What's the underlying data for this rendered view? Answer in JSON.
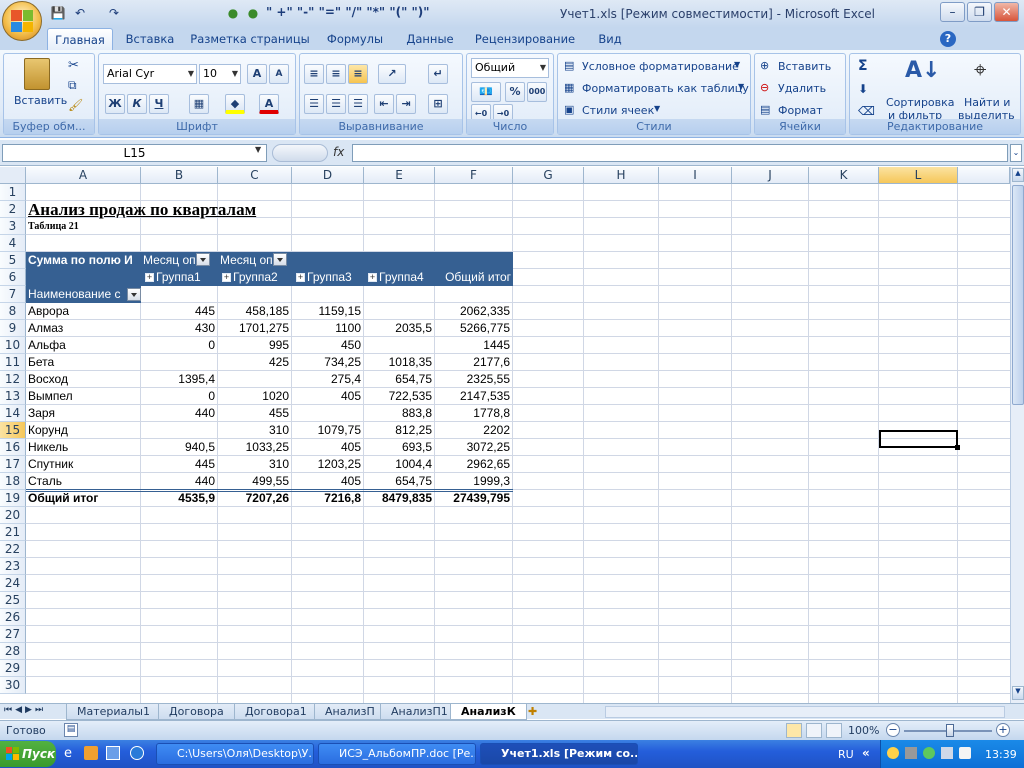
{
  "window": {
    "title": "Учет1.xls  [Режим совместимости] - Microsoft Excel"
  },
  "qat": {
    "formula_buttons": "\" +\" \"-\" \"=\" \"/\" \"*\" \"(\" \")\""
  },
  "tabs": [
    "Главная",
    "Вставка",
    "Разметка страницы",
    "Формулы",
    "Данные",
    "Рецензирование",
    "Вид"
  ],
  "ribbon": {
    "clipboard": {
      "paste": "Вставить",
      "label": "Буфер обм..."
    },
    "font": {
      "name": "Arial Cyr",
      "size": "10",
      "bold": "Ж",
      "italic": "К",
      "underline": "Ч",
      "label": "Шрифт"
    },
    "alignment": {
      "label": "Выравнивание"
    },
    "number": {
      "format": "Общий",
      "label": "Число",
      "percent": "%",
      "thousands": "000"
    },
    "styles": {
      "conditional": "Условное форматирование",
      "as_table": "Форматировать как таблицу",
      "cell_styles": "Стили ячеек",
      "label": "Стили"
    },
    "cells": {
      "insert": "Вставить",
      "delete": "Удалить",
      "format": "Формат",
      "label": "Ячейки"
    },
    "editing": {
      "sum": "Σ",
      "sort_line1": "Сортировка",
      "sort_line2": "и фильтр",
      "find_line1": "Найти и",
      "find_line2": "выделить",
      "label": "Редактирование"
    }
  },
  "formula_bar": {
    "name_box": "L15",
    "fx": "fx",
    "value": ""
  },
  "columns": [
    "A",
    "B",
    "C",
    "D",
    "E",
    "F",
    "G",
    "H",
    "I",
    "J",
    "K",
    "L"
  ],
  "rows": [
    "1",
    "2",
    "3",
    "4",
    "5",
    "6",
    "7",
    "8",
    "9",
    "10",
    "11",
    "12",
    "13",
    "14",
    "15",
    "16",
    "17",
    "18",
    "19",
    "20",
    "21",
    "22",
    "23",
    "24",
    "25",
    "26",
    "27",
    "28",
    "29",
    "30"
  ],
  "sheet": {
    "title": "Анализ продаж по кварталам",
    "subtitle": "Таблица 21",
    "pivot_header_a": "Сумма по полю И",
    "pivot_header_b": "Месяц оп",
    "pivot_header_c": "Месяц оп",
    "groups": [
      "Группа1",
      "Группа2",
      "Группа3",
      "Группа4"
    ],
    "grand_total_col": "Общий итог",
    "row_field": "Наименование с",
    "data": [
      [
        "Аврора",
        "445",
        "458,185",
        "1159,15",
        "",
        "2062,335"
      ],
      [
        "Алмаз",
        "430",
        "1701,275",
        "1100",
        "2035,5",
        "5266,775"
      ],
      [
        "Альфа",
        "0",
        "995",
        "450",
        "",
        "1445"
      ],
      [
        "Бета",
        "",
        "425",
        "734,25",
        "1018,35",
        "2177,6"
      ],
      [
        "Восход",
        "1395,4",
        "",
        "275,4",
        "654,75",
        "2325,55"
      ],
      [
        "Вымпел",
        "0",
        "1020",
        "405",
        "722,535",
        "2147,535"
      ],
      [
        "Заря",
        "440",
        "455",
        "",
        "883,8",
        "1778,8"
      ],
      [
        "Корунд",
        "",
        "310",
        "1079,75",
        "812,25",
        "2202"
      ],
      [
        "Никель",
        "940,5",
        "1033,25",
        "405",
        "693,5",
        "3072,25"
      ],
      [
        "Спутник",
        "445",
        "310",
        "1203,25",
        "1004,4",
        "2962,65"
      ],
      [
        "Сталь",
        "440",
        "499,55",
        "405",
        "654,75",
        "1999,3"
      ]
    ],
    "total": [
      "Общий итог",
      "4535,9",
      "7207,26",
      "7216,8",
      "8479,835",
      "27439,795"
    ]
  },
  "sheet_tabs": [
    "Материалы1",
    "Договора",
    "Договора1",
    "АнализП",
    "АнализП1",
    "АнализК"
  ],
  "status": {
    "ready": "Готово",
    "zoom": "100%"
  },
  "taskbar": {
    "start": "Пуск",
    "tasks": [
      "C:\\Users\\Оля\\Desktop\\У...",
      "ИСЭ_АльбомПР.doc [Ре...",
      "Учет1.xls  [Режим со..."
    ],
    "lang": "RU",
    "clock": "13:39"
  }
}
